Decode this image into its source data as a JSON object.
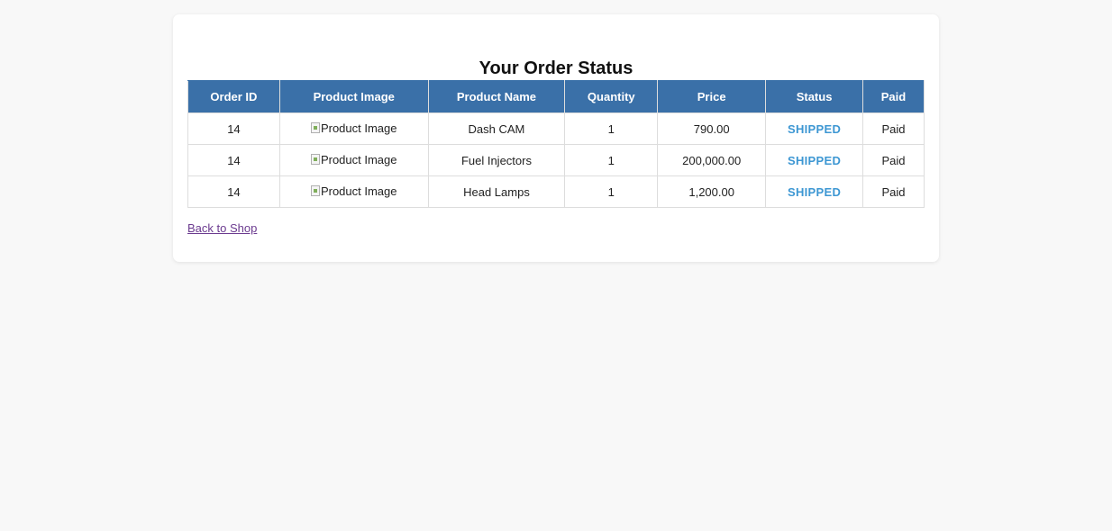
{
  "page": {
    "title": "Your Order Status"
  },
  "table": {
    "headers": [
      "Order ID",
      "Product Image",
      "Product Name",
      "Quantity",
      "Price",
      "Status",
      "Paid"
    ],
    "rows": [
      {
        "order_id": "14",
        "image_alt": "Product Image",
        "product_name": "Dash CAM",
        "quantity": "1",
        "price": "790.00",
        "status": "SHIPPED",
        "paid": "Paid"
      },
      {
        "order_id": "14",
        "image_alt": "Product Image",
        "product_name": "Fuel Injectors",
        "quantity": "1",
        "price": "200,000.00",
        "status": "SHIPPED",
        "paid": "Paid"
      },
      {
        "order_id": "14",
        "image_alt": "Product Image",
        "product_name": "Head Lamps",
        "quantity": "1",
        "price": "1,200.00",
        "status": "SHIPPED",
        "paid": "Paid"
      }
    ]
  },
  "links": {
    "back_to_shop": "Back to Shop"
  },
  "colors": {
    "header_bg": "#3a70a8",
    "status_shipped": "#3d97d3",
    "link_visited": "#6b3a8f",
    "page_bg": "#f8f8f8"
  },
  "icons": {
    "product_image": "broken-image-icon"
  }
}
